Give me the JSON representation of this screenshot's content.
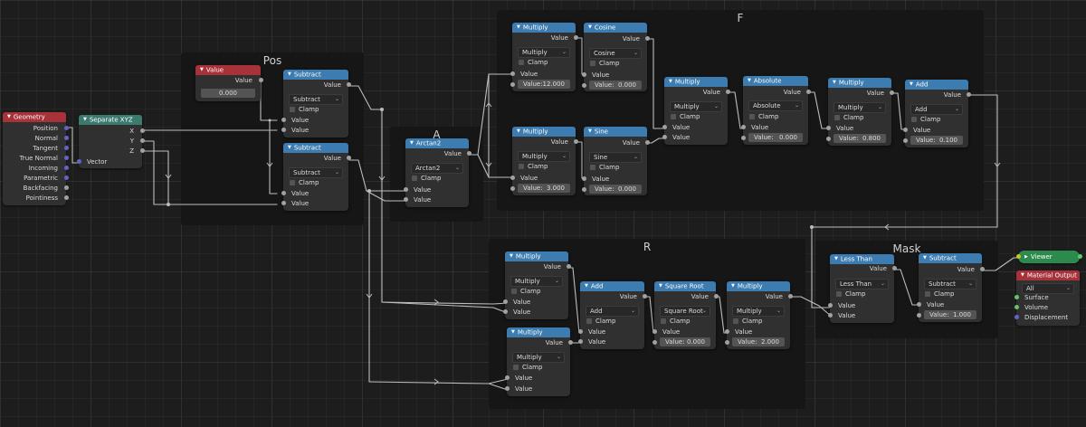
{
  "frames": {
    "pos": {
      "title": "Pos"
    },
    "a": {
      "title": "A"
    },
    "f": {
      "title": "F"
    },
    "r": {
      "title": "R"
    },
    "mask": {
      "title": "Mask"
    }
  },
  "common": {
    "value": "Value",
    "clamp": "Clamp",
    "value_field": "Value:"
  },
  "nodes": {
    "geometry": {
      "title": "Geometry",
      "outputs": [
        "Position",
        "Normal",
        "Tangent",
        "True Normal",
        "Incoming",
        "Parametric",
        "Backfacing",
        "Pointiness"
      ]
    },
    "separate_xyz": {
      "title": "Separate XYZ",
      "outputs": [
        "X",
        "Y",
        "Z"
      ],
      "input": "Vector"
    },
    "value_node": {
      "title": "Value",
      "output": "Value",
      "value": "0.000"
    },
    "subtract_pos1": {
      "title": "Subtract",
      "operation": "Subtract"
    },
    "subtract_pos2": {
      "title": "Subtract",
      "operation": "Subtract"
    },
    "arctan2": {
      "title": "Arctan2",
      "operation": "Arctan2"
    },
    "multiply_f1": {
      "title": "Multiply",
      "operation": "Multiply",
      "value": "12.000"
    },
    "cosine": {
      "title": "Cosine",
      "operation": "Cosine",
      "value": "0.000"
    },
    "multiply_f2": {
      "title": "Multiply",
      "operation": "Multiply",
      "value": "3.000"
    },
    "sine": {
      "title": "Sine",
      "operation": "Sine",
      "value": "0.000"
    },
    "multiply_f3": {
      "title": "Multiply",
      "operation": "Multiply"
    },
    "absolute": {
      "title": "Absolute",
      "operation": "Absolute",
      "value": "0.000"
    },
    "multiply_f4": {
      "title": "Multiply",
      "operation": "Multiply",
      "value": "0.800"
    },
    "add_f": {
      "title": "Add",
      "operation": "Add",
      "value": "0.100"
    },
    "multiply_r1": {
      "title": "Multiply",
      "operation": "Multiply"
    },
    "multiply_r2": {
      "title": "Multiply",
      "operation": "Multiply"
    },
    "add_r": {
      "title": "Add",
      "operation": "Add"
    },
    "square_root": {
      "title": "Square Root",
      "operation": "Square Root",
      "value": "0.000"
    },
    "multiply_r3": {
      "title": "Multiply",
      "operation": "Multiply",
      "value": "2.000"
    },
    "less_than": {
      "title": "Less Than",
      "operation": "Less Than"
    },
    "subtract_mask": {
      "title": "Subtract",
      "operation": "Subtract",
      "value": "1.000"
    },
    "viewer": {
      "title": "Viewer"
    },
    "material_output": {
      "title": "Material Output",
      "target": "All",
      "inputs": [
        "Surface",
        "Volume",
        "Displacement"
      ]
    }
  },
  "colors": {
    "header_math": "#3c7cb0",
    "header_input": "#a8323a",
    "header_converter": "#3c7a70",
    "header_viewer": "#2d8a4e",
    "socket_float": "#a1a1a1",
    "socket_vector": "#6464c8",
    "socket_color": "#c7c729",
    "socket_shader": "#63c763",
    "wire": "#bdbdbd"
  }
}
